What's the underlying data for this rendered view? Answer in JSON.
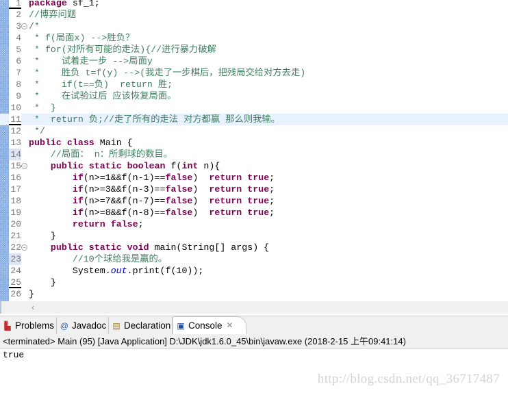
{
  "editor": {
    "lines": [
      {
        "n": "1",
        "segs": [
          [
            "k",
            "package"
          ],
          [
            "p",
            " sf_1;"
          ]
        ]
      },
      {
        "n": "2",
        "segs": [
          [
            "c",
            "//博弈问题"
          ]
        ]
      },
      {
        "n": "3",
        "fold": true,
        "segs": [
          [
            "c",
            "/*"
          ]
        ]
      },
      {
        "n": "4",
        "segs": [
          [
            "c",
            " * f(局面x) -->胜负？"
          ]
        ]
      },
      {
        "n": "5",
        "segs": [
          [
            "c",
            " * for(对所有可能的走法){//进行暴力破解"
          ]
        ]
      },
      {
        "n": "6",
        "segs": [
          [
            "c",
            " *    试着走一步 -->局面y"
          ]
        ]
      },
      {
        "n": "7",
        "segs": [
          [
            "c",
            " *    胜负 t=f(y) -->(我走了一步棋后，把残局交给对方去走)"
          ]
        ]
      },
      {
        "n": "8",
        "segs": [
          [
            "c",
            " *    if(t==负)  return 胜;"
          ]
        ]
      },
      {
        "n": "9",
        "segs": [
          [
            "c",
            " *    在试验过后 应该恢复局面。"
          ]
        ]
      },
      {
        "n": "10",
        "segs": [
          [
            "c",
            " *  }"
          ]
        ]
      },
      {
        "n": "11",
        "current": true,
        "segs": [
          [
            "c",
            " *  return 负;//走了所有的走法 对方都赢 那么则我输。"
          ]
        ]
      },
      {
        "n": "12",
        "segs": [
          [
            "c",
            " */"
          ]
        ]
      },
      {
        "n": "13",
        "segs": [
          [
            "k",
            "public"
          ],
          [
            "p",
            " "
          ],
          [
            "k",
            "class"
          ],
          [
            "p",
            " Main {"
          ]
        ]
      },
      {
        "n": "14",
        "segs": [
          [
            "p",
            "    "
          ],
          [
            "c",
            "//局面： n：所剩球的数目。"
          ]
        ]
      },
      {
        "n": "15",
        "fold": true,
        "segs": [
          [
            "p",
            "    "
          ],
          [
            "k",
            "public"
          ],
          [
            "p",
            " "
          ],
          [
            "k",
            "static"
          ],
          [
            "p",
            " "
          ],
          [
            "k",
            "boolean"
          ],
          [
            "p",
            " f("
          ],
          [
            "k",
            "int"
          ],
          [
            "p",
            " n){"
          ]
        ]
      },
      {
        "n": "16",
        "segs": [
          [
            "p",
            "        "
          ],
          [
            "k",
            "if"
          ],
          [
            "p",
            "(n>=1&&f(n-1)=="
          ],
          [
            "k",
            "false"
          ],
          [
            "p",
            ")  "
          ],
          [
            "k",
            "return"
          ],
          [
            "p",
            " "
          ],
          [
            "k",
            "true"
          ],
          [
            "p",
            ";"
          ]
        ]
      },
      {
        "n": "17",
        "segs": [
          [
            "p",
            "        "
          ],
          [
            "k",
            "if"
          ],
          [
            "p",
            "(n>=3&&f(n-3)=="
          ],
          [
            "k",
            "false"
          ],
          [
            "p",
            ")  "
          ],
          [
            "k",
            "return"
          ],
          [
            "p",
            " "
          ],
          [
            "k",
            "true"
          ],
          [
            "p",
            ";"
          ]
        ]
      },
      {
        "n": "18",
        "segs": [
          [
            "p",
            "        "
          ],
          [
            "k",
            "if"
          ],
          [
            "p",
            "(n>=7&&f(n-7)=="
          ],
          [
            "k",
            "false"
          ],
          [
            "p",
            ")  "
          ],
          [
            "k",
            "return"
          ],
          [
            "p",
            " "
          ],
          [
            "k",
            "true"
          ],
          [
            "p",
            ";"
          ]
        ]
      },
      {
        "n": "19",
        "segs": [
          [
            "p",
            "        "
          ],
          [
            "k",
            "if"
          ],
          [
            "p",
            "(n>=8&&f(n-8)=="
          ],
          [
            "k",
            "false"
          ],
          [
            "p",
            ")  "
          ],
          [
            "k",
            "return"
          ],
          [
            "p",
            " "
          ],
          [
            "k",
            "true"
          ],
          [
            "p",
            ";"
          ]
        ]
      },
      {
        "n": "20",
        "segs": [
          [
            "p",
            "        "
          ],
          [
            "k",
            "return"
          ],
          [
            "p",
            " "
          ],
          [
            "k",
            "false"
          ],
          [
            "p",
            ";"
          ]
        ]
      },
      {
        "n": "21",
        "segs": [
          [
            "p",
            "    }"
          ]
        ]
      },
      {
        "n": "22",
        "fold": true,
        "segs": [
          [
            "p",
            "    "
          ],
          [
            "k",
            "public"
          ],
          [
            "p",
            " "
          ],
          [
            "k",
            "static"
          ],
          [
            "p",
            " "
          ],
          [
            "k",
            "void"
          ],
          [
            "p",
            " main(String[] args) {"
          ]
        ]
      },
      {
        "n": "23",
        "segs": [
          [
            "p",
            "        "
          ],
          [
            "c",
            "//10个球给我是赢的。"
          ]
        ]
      },
      {
        "n": "24",
        "segs": [
          [
            "p",
            "        System."
          ],
          [
            "f",
            "out"
          ],
          [
            "p",
            ".print(f(10));"
          ]
        ]
      },
      {
        "n": "25",
        "segs": [
          [
            "p",
            "    }"
          ]
        ]
      },
      {
        "n": "26",
        "segs": [
          [
            "p",
            "}"
          ]
        ]
      }
    ]
  },
  "tabs": [
    {
      "label": "Problems",
      "icon": "problems-icon"
    },
    {
      "label": "Javadoc",
      "icon": "at-icon"
    },
    {
      "label": "Declaration",
      "icon": "declaration-icon"
    },
    {
      "label": "Console",
      "icon": "console-icon",
      "active": true
    }
  ],
  "status": "<terminated> Main (95) [Java Application] D:\\JDK\\jdk1.6.0_45\\bin\\javaw.exe (2018-2-15 上午09:41:14)",
  "console_output": "true",
  "watermark": "http://blog.csdn.net/qq_36717487",
  "colors": {
    "keyword": "#7f0055",
    "comment": "#3f7f5f",
    "field": "#0000c0",
    "current_line": "#e8f2fe"
  }
}
